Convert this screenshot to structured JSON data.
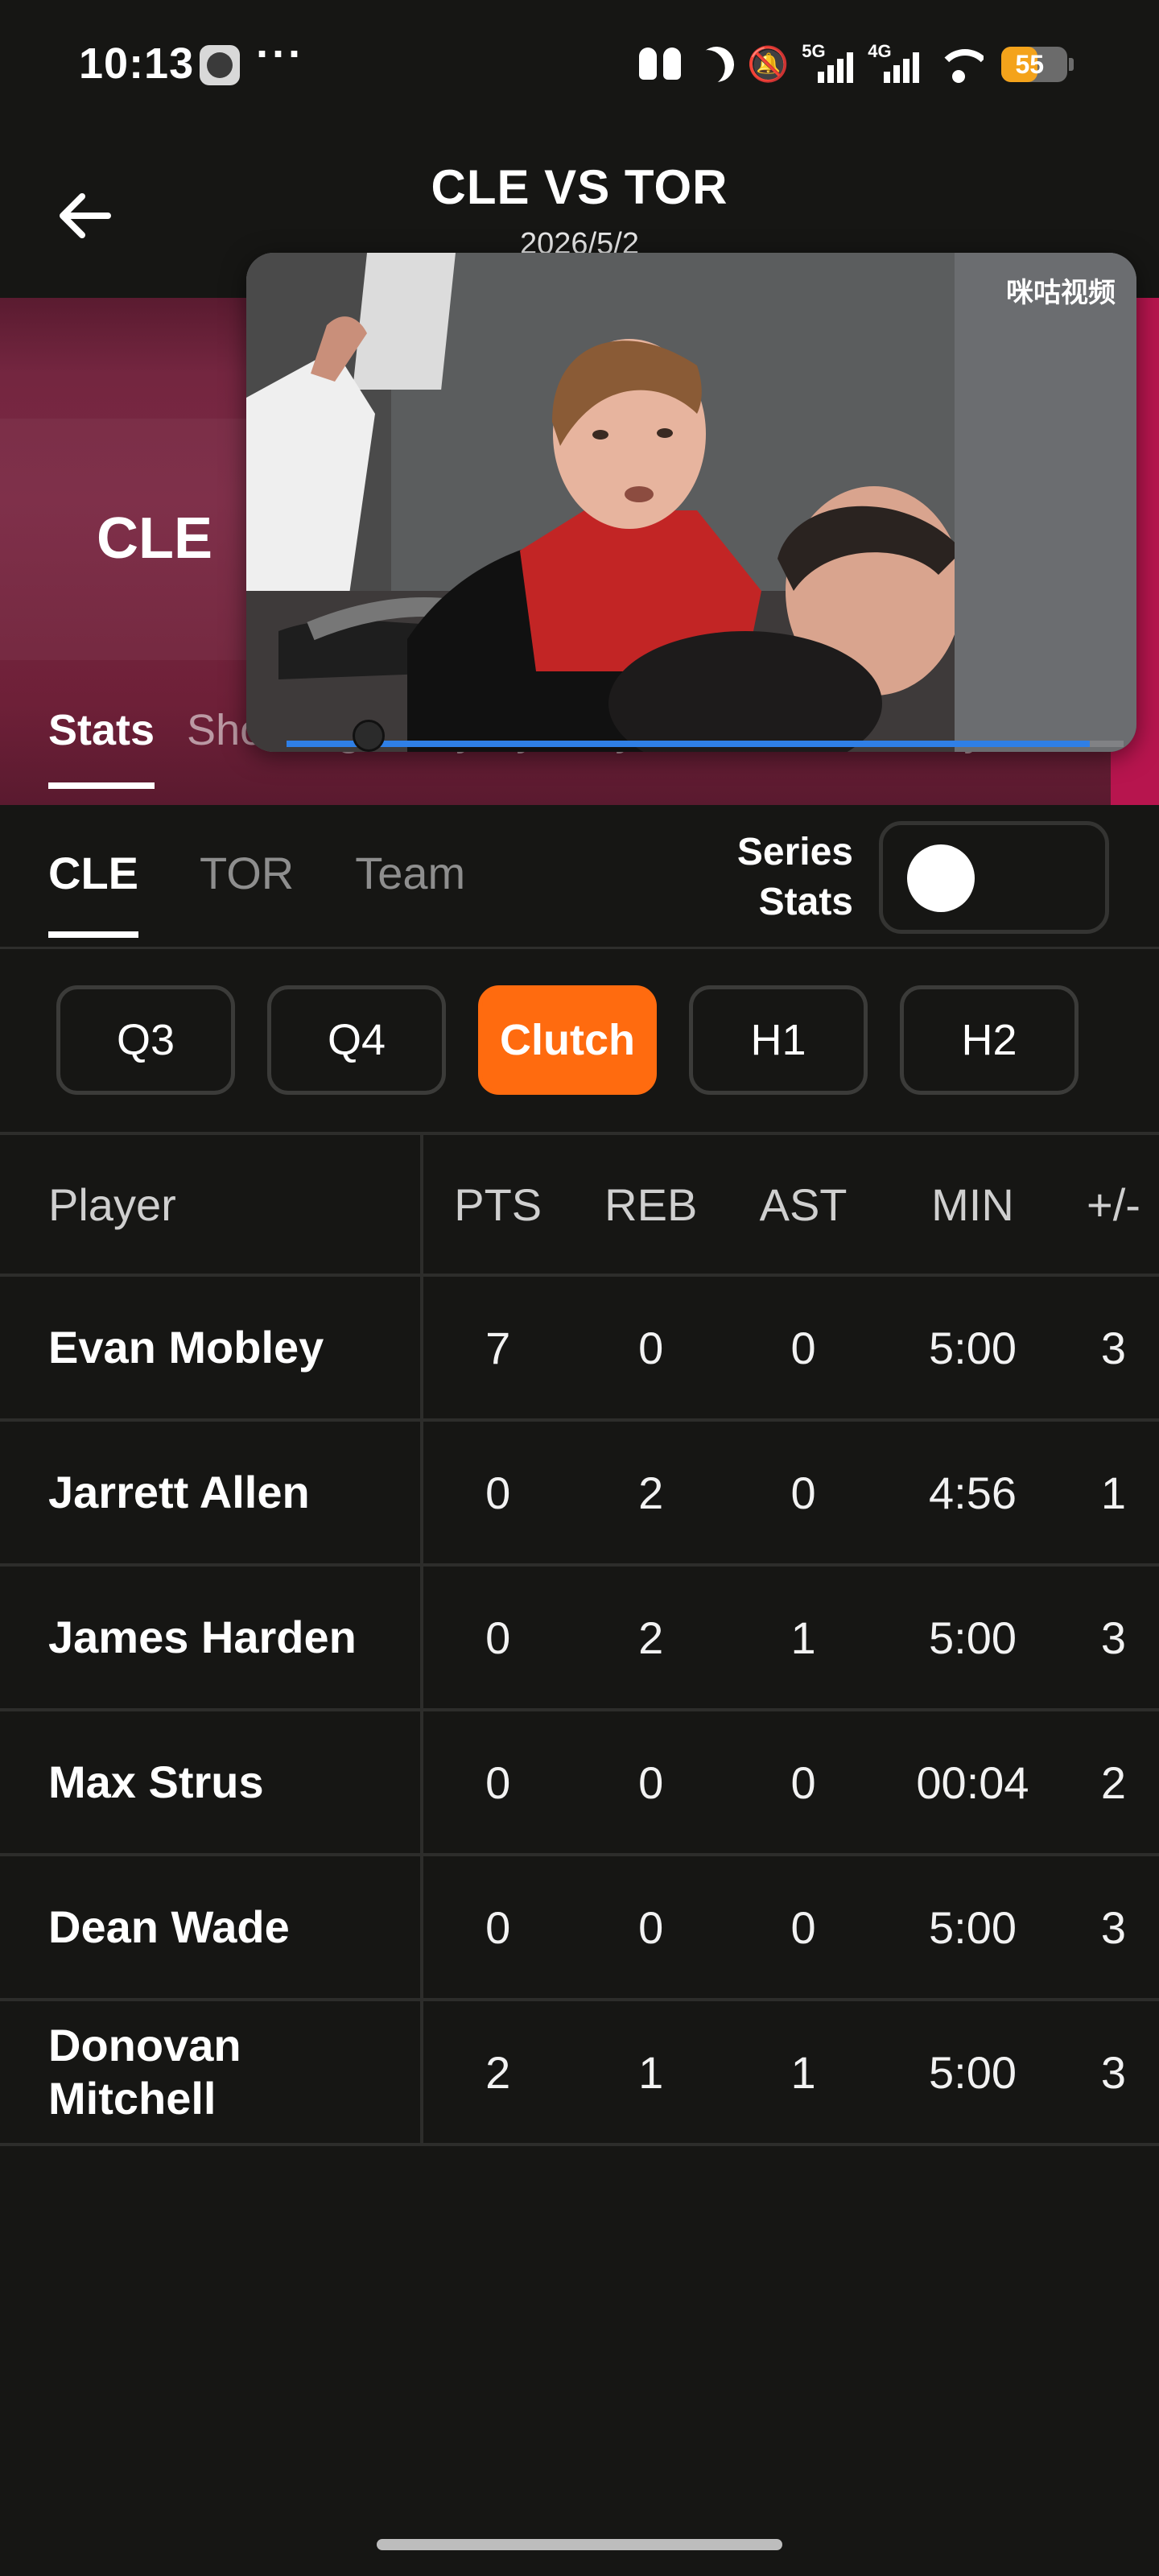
{
  "status_bar": {
    "time": "10:13",
    "more": "···",
    "network_1": "5G",
    "network_2": "4G",
    "battery_level": "55",
    "battery_fraction": 0.55,
    "icons": [
      "clock-app-icon",
      "earbuds-icon",
      "moon-icon",
      "bell-muted-icon",
      "signal-icon",
      "wifi-icon",
      "battery-icon"
    ]
  },
  "header": {
    "title": "CLE VS TOR",
    "date": "2026/5/2"
  },
  "banner": {
    "team": "CLE",
    "tabs": [
      "Stats",
      "Shot Log",
      "Play-by-Play",
      "Game Summary"
    ],
    "active_tab": "Stats",
    "color": "#7a2843"
  },
  "video": {
    "watermark": "咪咕视频",
    "progress": 0.96,
    "progress_color": "#2f7fe6"
  },
  "sub_tabs": {
    "items": [
      "CLE",
      "TOR",
      "Team"
    ],
    "active": "CLE",
    "series_label": "Series Stats",
    "series_on": false
  },
  "periods": {
    "items": [
      "Q3",
      "Q4",
      "Clutch",
      "H1",
      "H2"
    ],
    "active": "Clutch",
    "accent": "#ff6b0f"
  },
  "table": {
    "headers": [
      "Player",
      "PTS",
      "REB",
      "AST",
      "MIN",
      "+/-"
    ],
    "rows": [
      {
        "player": "Evan Mobley",
        "pts": "7",
        "reb": "0",
        "ast": "0",
        "min": "5:00",
        "pm": "3"
      },
      {
        "player": "Jarrett Allen",
        "pts": "0",
        "reb": "2",
        "ast": "0",
        "min": "4:56",
        "pm": "1"
      },
      {
        "player": "James Harden",
        "pts": "0",
        "reb": "2",
        "ast": "1",
        "min": "5:00",
        "pm": "3"
      },
      {
        "player": "Max Strus",
        "pts": "0",
        "reb": "0",
        "ast": "0",
        "min": "00:04",
        "pm": "2"
      },
      {
        "player": "Dean Wade",
        "pts": "0",
        "reb": "0",
        "ast": "0",
        "min": "5:00",
        "pm": "3"
      },
      {
        "player": "Donovan Mitchell",
        "pts": "2",
        "reb": "1",
        "ast": "1",
        "min": "5:00",
        "pm": "3"
      }
    ]
  }
}
